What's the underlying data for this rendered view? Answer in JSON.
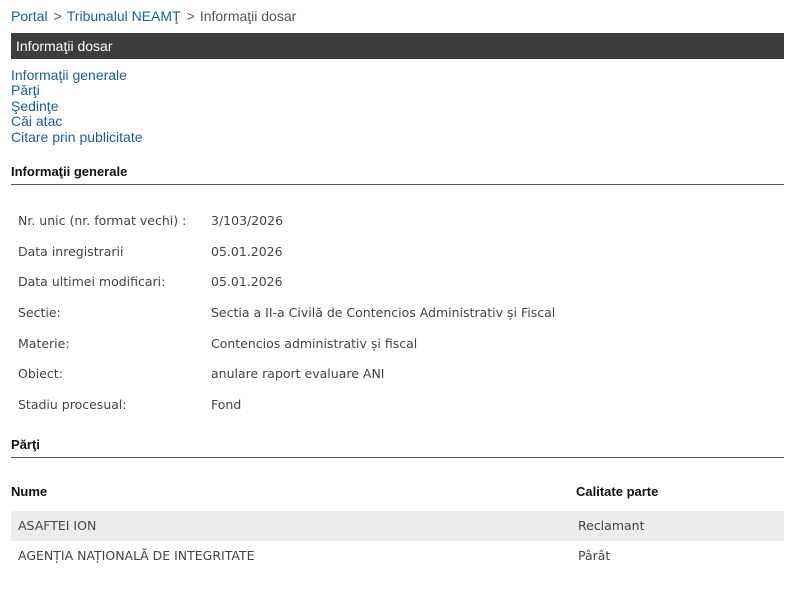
{
  "breadcrumb": {
    "items": [
      "Portal",
      "Tribunalul NEAMŢ",
      "Informaţii dosar"
    ],
    "separator": ">"
  },
  "title_bar": {
    "label": "Informaţii dosar"
  },
  "toc": {
    "links": [
      "Informaţii generale",
      "Părţi",
      "Şedinţe",
      "Căi atac",
      "Citare prin publicitate"
    ]
  },
  "general": {
    "heading": "Informaţii generale",
    "rows": [
      {
        "label": "Nr. unic (nr. format vechi) :",
        "value": "3/103/2026"
      },
      {
        "label": "Data inregistrarii",
        "value": "05.01.2026"
      },
      {
        "label": "Data ultimei modificari:",
        "value": "05.01.2026"
      },
      {
        "label": "Sectie:",
        "value": "Sectia a II-a Civilă de Contencios Administrativ și Fiscal"
      },
      {
        "label": "Materie:",
        "value": "Contencios administrativ și fiscal"
      },
      {
        "label": "Obiect:",
        "value": "anulare raport evaluare ANI"
      },
      {
        "label": "Stadiu procesual:",
        "value": "Fond"
      }
    ]
  },
  "parti": {
    "heading": "Părţi",
    "columns": [
      "Nume",
      "Calitate parte"
    ],
    "rows": [
      {
        "nume": "ASAFTEI ION",
        "calitate": "Reclamant"
      },
      {
        "nume": "AGENȚIA NAȚIONALĂ DE INTEGRITATE",
        "calitate": "Pârât"
      }
    ]
  },
  "colors": {
    "link": "#1a5e9c",
    "title_bar_bg": "#3d3d3d",
    "row_shade": "#ececec"
  }
}
